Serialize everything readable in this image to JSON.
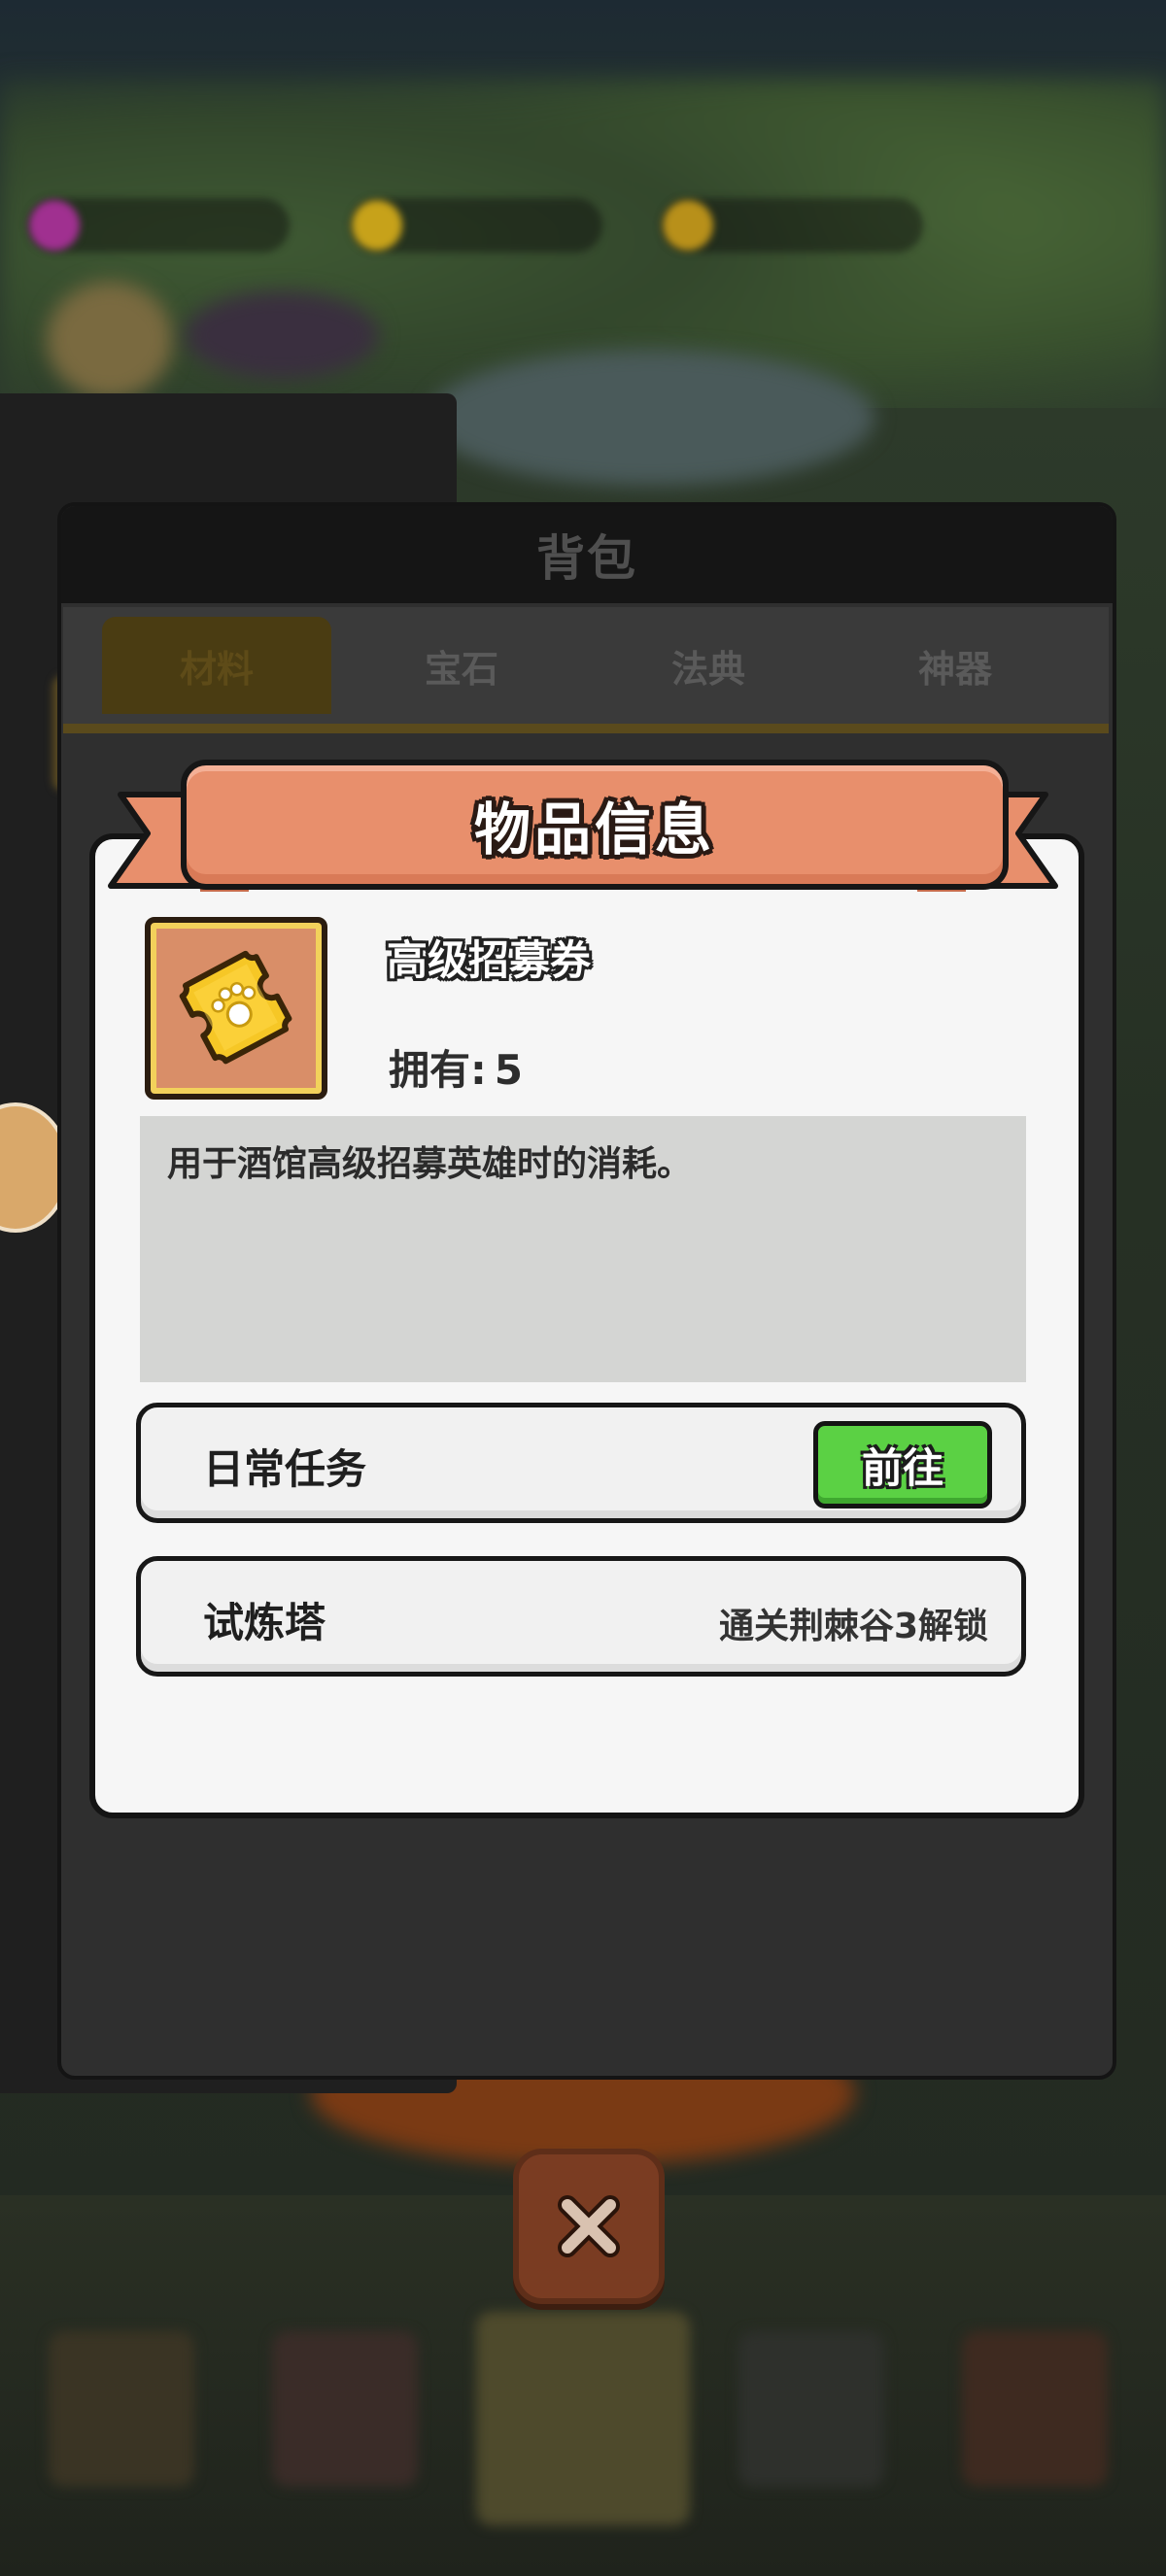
{
  "bag": {
    "title": "背包",
    "tabs": [
      {
        "label": "材料",
        "active": true
      },
      {
        "label": "宝石",
        "active": false
      },
      {
        "label": "法典",
        "active": false
      },
      {
        "label": "神器",
        "active": false
      }
    ]
  },
  "item_info": {
    "title": "物品信息",
    "item_name": "高级招募券",
    "owned_label": "拥有:",
    "owned_count": "5",
    "description": "用于酒馆高级招募英雄时的消耗。",
    "sources": [
      {
        "label": "日常任务",
        "action_label": "前往",
        "locked": false
      },
      {
        "label": "试炼塔",
        "lock_text": "通关荆棘谷3解锁",
        "locked": true
      }
    ]
  },
  "colors": {
    "ribbon": "#e88f6c",
    "go_button": "#5bd144",
    "item_bg": "#d98e68",
    "panel_bg": "#f6f6f6"
  },
  "icons": {
    "item": "golden-ticket-paw-icon",
    "close": "close-x-icon"
  }
}
